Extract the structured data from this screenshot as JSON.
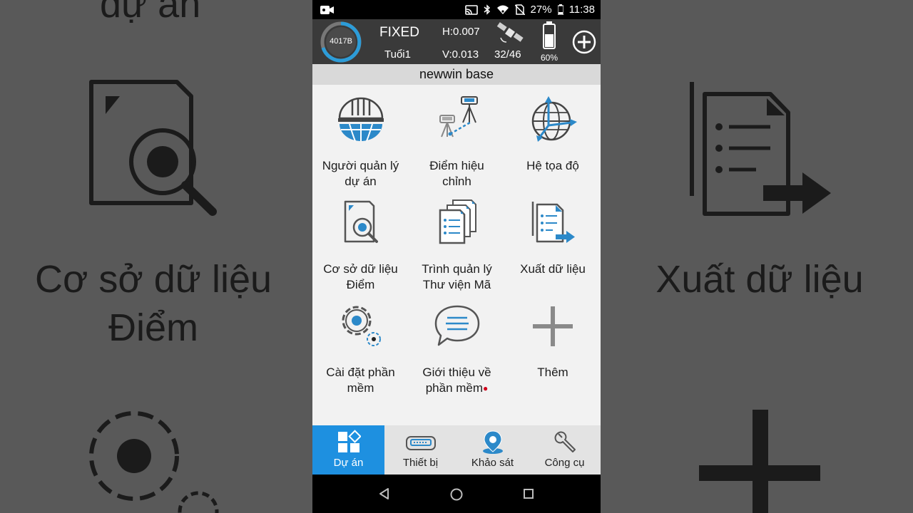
{
  "background": {
    "left_top_text": "dự án",
    "left_mid_line1": "Cơ sở dữ liệu",
    "left_mid_line2": "Điểm",
    "right_mid_text": "Xuất dữ liệu"
  },
  "status_bar": {
    "battery_percent": "27%",
    "time": "11:38"
  },
  "top_bar": {
    "device_id": "4017B",
    "solution": "FIXED",
    "age": "Tuổi1",
    "h_precision": "H:0.007",
    "v_precision": "V:0.013",
    "satellites": "32/46",
    "device_battery": "60%"
  },
  "project_name": "newwin base",
  "menu": [
    {
      "line1": "Người quản lý",
      "line2": "dự án",
      "icon": "helmet-globe-icon"
    },
    {
      "line1": "Điểm hiệu",
      "line2": "chỉnh",
      "icon": "survey-tripod-icon"
    },
    {
      "line1": "Hệ tọa độ",
      "line2": "",
      "icon": "coordinate-globe-icon"
    },
    {
      "line1": "Cơ sở dữ liệu",
      "line2": "Điểm",
      "icon": "document-search-icon"
    },
    {
      "line1": "Trình quản lý",
      "line2": "Thư viện Mã",
      "icon": "document-stack-icon"
    },
    {
      "line1": "Xuất dữ liệu",
      "line2": "",
      "icon": "document-export-icon"
    },
    {
      "line1": "Cài đặt phần",
      "line2": "mềm",
      "icon": "gear-icon"
    },
    {
      "line1": "Giới thiệu về",
      "line2": "phần mềm",
      "icon": "chat-bubble-icon"
    },
    {
      "line1": "Thêm",
      "line2": "",
      "icon": "plus-icon"
    }
  ],
  "bottom_nav": [
    {
      "label": "Dự án",
      "icon": "grid-icon",
      "active": true
    },
    {
      "label": "Thiết bị",
      "icon": "receiver-icon",
      "active": false
    },
    {
      "label": "Khảo sát",
      "icon": "location-pin-icon",
      "active": false
    },
    {
      "label": "Công cụ",
      "icon": "wrench-icon",
      "active": false
    }
  ],
  "colors": {
    "accent": "#1e90e0",
    "top_bar": "#3a3a3a",
    "icon_blue": "#2c89c9"
  }
}
